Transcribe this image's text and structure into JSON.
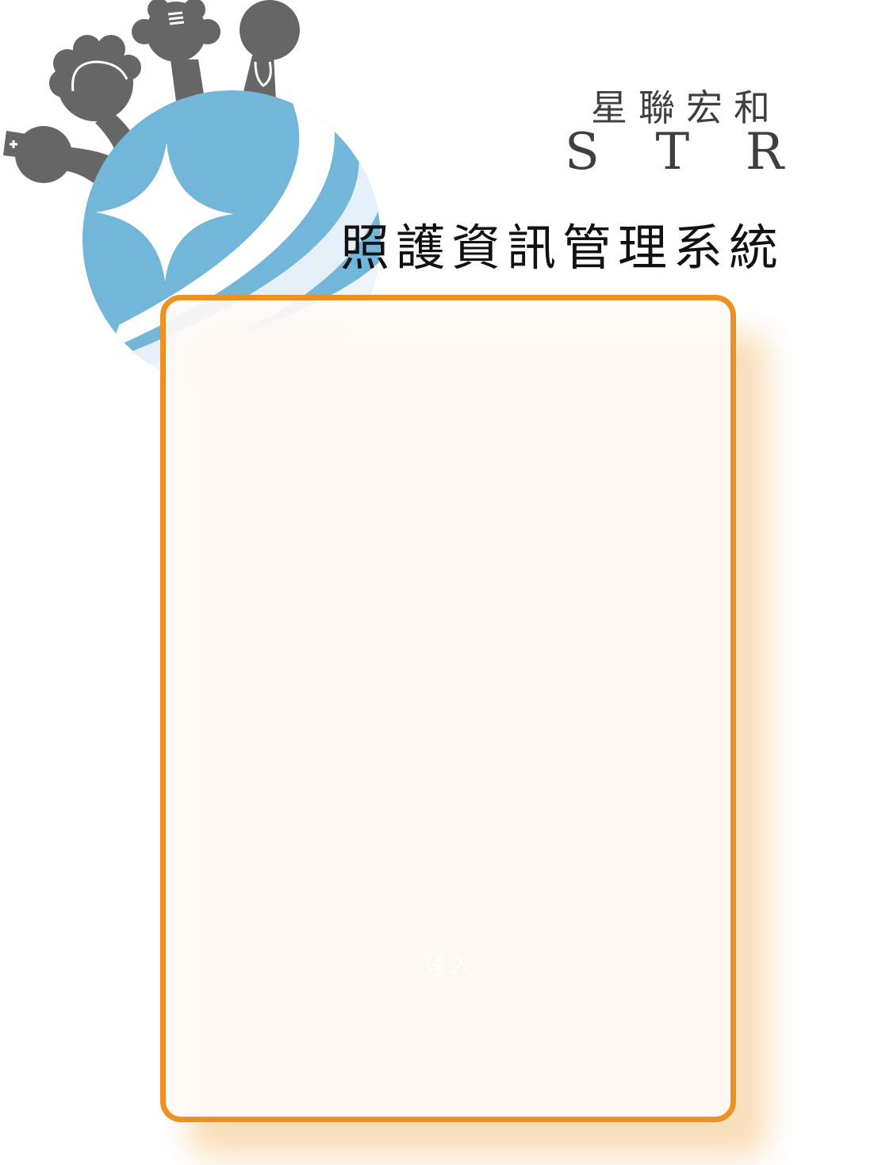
{
  "header": {
    "company_name": "星聯宏和",
    "company_abbr": [
      "S",
      "T",
      "R"
    ],
    "system_title": "照護資訊管理系統"
  },
  "login": {
    "button_label": "登入"
  },
  "colors": {
    "brand_blue": "#72b6da",
    "figure_gray": "#666666",
    "card_border": "#ec9224",
    "card_shadow": "#f8d9b0"
  }
}
